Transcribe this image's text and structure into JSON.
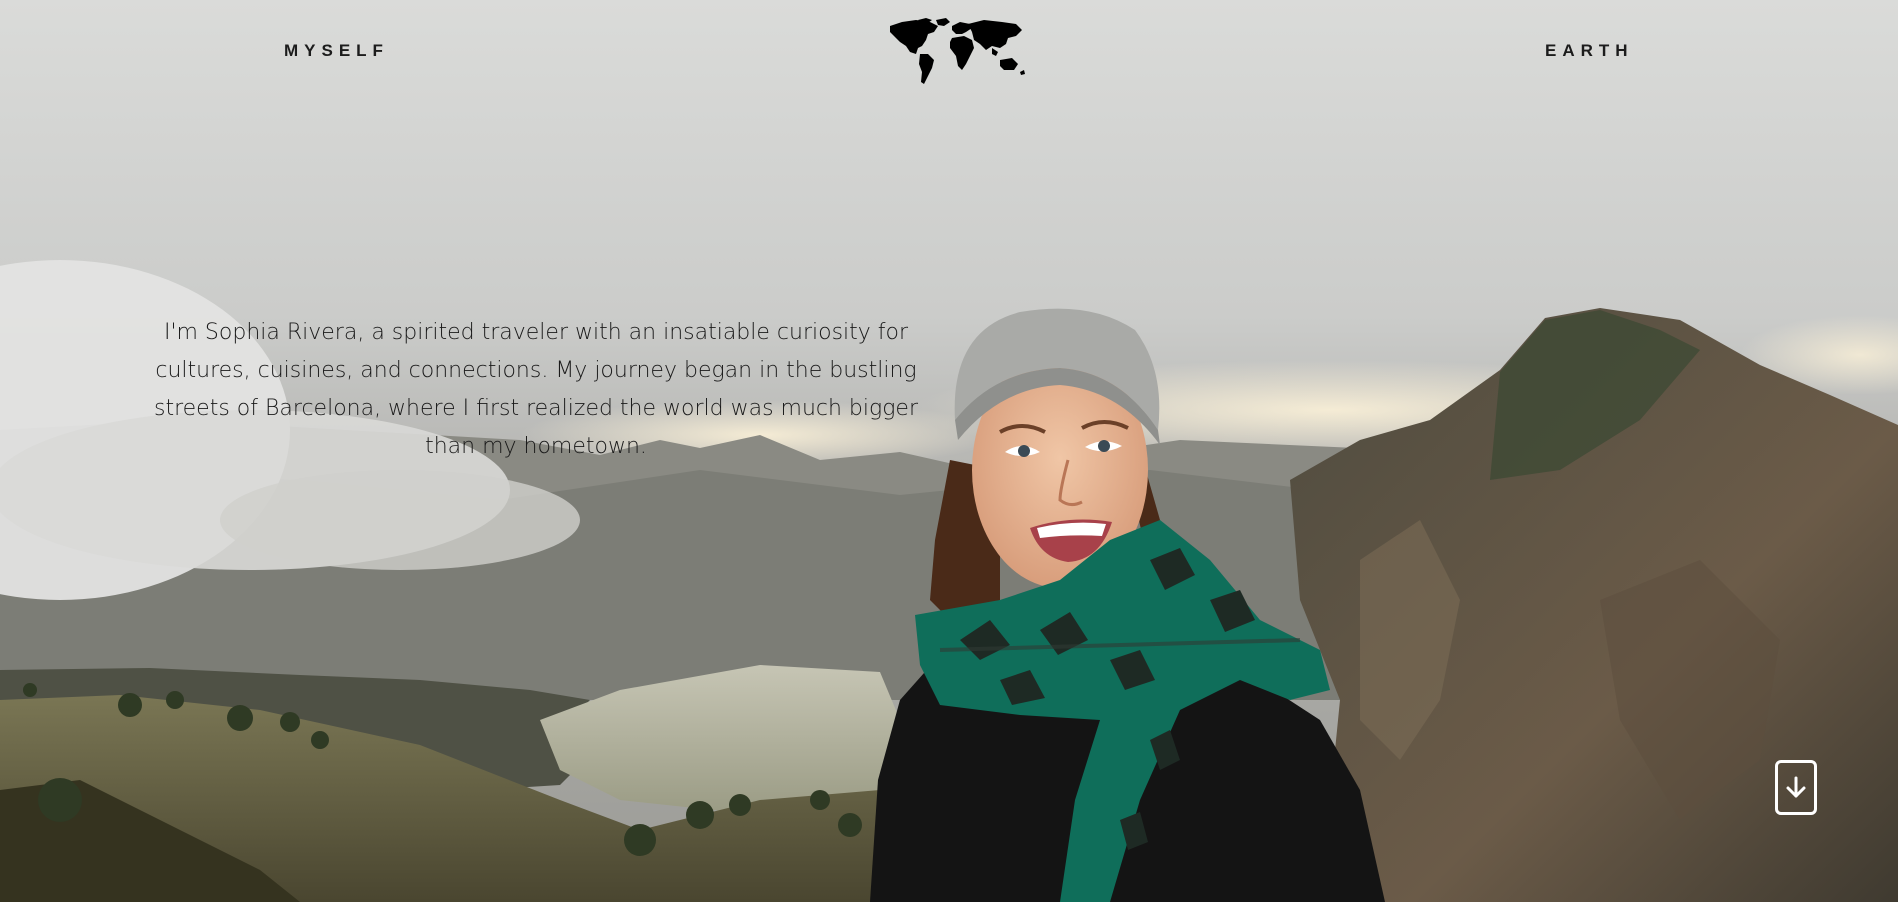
{
  "nav": {
    "left_label": "MYSELF",
    "right_label": "EARTH",
    "logo_icon": "world-map-icon"
  },
  "intro": {
    "text": "I'm Sophia Rivera, a spirited traveler with an insatiable curiosity for cultures, cuisines, and connections. My journey began in the bustling streets of Barcelona, where I first realized the world was much bigger than my hometown."
  },
  "scroll": {
    "icon": "arrow-down-icon"
  },
  "colors": {
    "text": "#1a1a1a",
    "scarf": "#0f6e5a",
    "button_border": "#ffffff"
  }
}
